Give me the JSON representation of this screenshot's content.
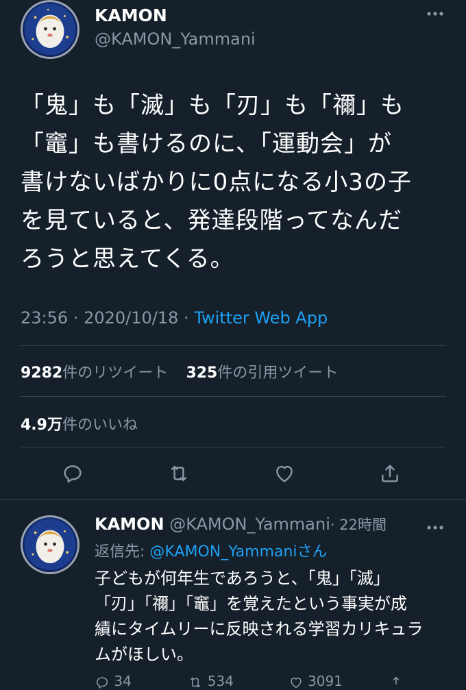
{
  "tweet": {
    "author_name": "KAMON",
    "author_handle": "@KAMON_Yammani",
    "text_lines": [
      "「鬼」も「滅」も「刃」も「禰」も",
      "「竈」も書けるのに、「運動会」が",
      "書けないばかりに0点になる小3の子",
      "を見ていると、発達段階ってなんだ",
      "ろうと思えてくる。"
    ],
    "time": "23:56",
    "date_sep": " · ",
    "date": "2020/10/18",
    "source_sep": " · ",
    "source": "Twitter Web App",
    "retweets_count": "9282",
    "retweets_label": "件のリツイート",
    "quotes_count": "325",
    "quotes_label": "件の引用ツイート",
    "likes_count": "4.9万",
    "likes_label": "件のいいね"
  },
  "reply": {
    "author_name": "KAMON",
    "author_handle": "@KAMON_Yammani",
    "age": "· 22時間",
    "reply_to_prefix": "返信先: ",
    "reply_to_handle": "@KAMON_Yammani",
    "reply_to_suffix": "さん",
    "text_lines": [
      "子どもが何年生であろうと、「鬼」「滅」",
      "「刃」「禰」「竈」を覚えたという事実が成",
      "績にタイムリーに反映される学習カリキュラ",
      "ムがほしい。"
    ],
    "reply_count": "34",
    "retweet_count": "534",
    "like_count": "3091"
  },
  "icons": [
    "more-icon",
    "reply-icon",
    "retweet-icon",
    "like-icon",
    "share-icon"
  ],
  "colors": {
    "background": "#15202b",
    "text": "#ffffff",
    "muted": "#8899a6",
    "link": "#1da1f2",
    "divider": "#38444d"
  }
}
